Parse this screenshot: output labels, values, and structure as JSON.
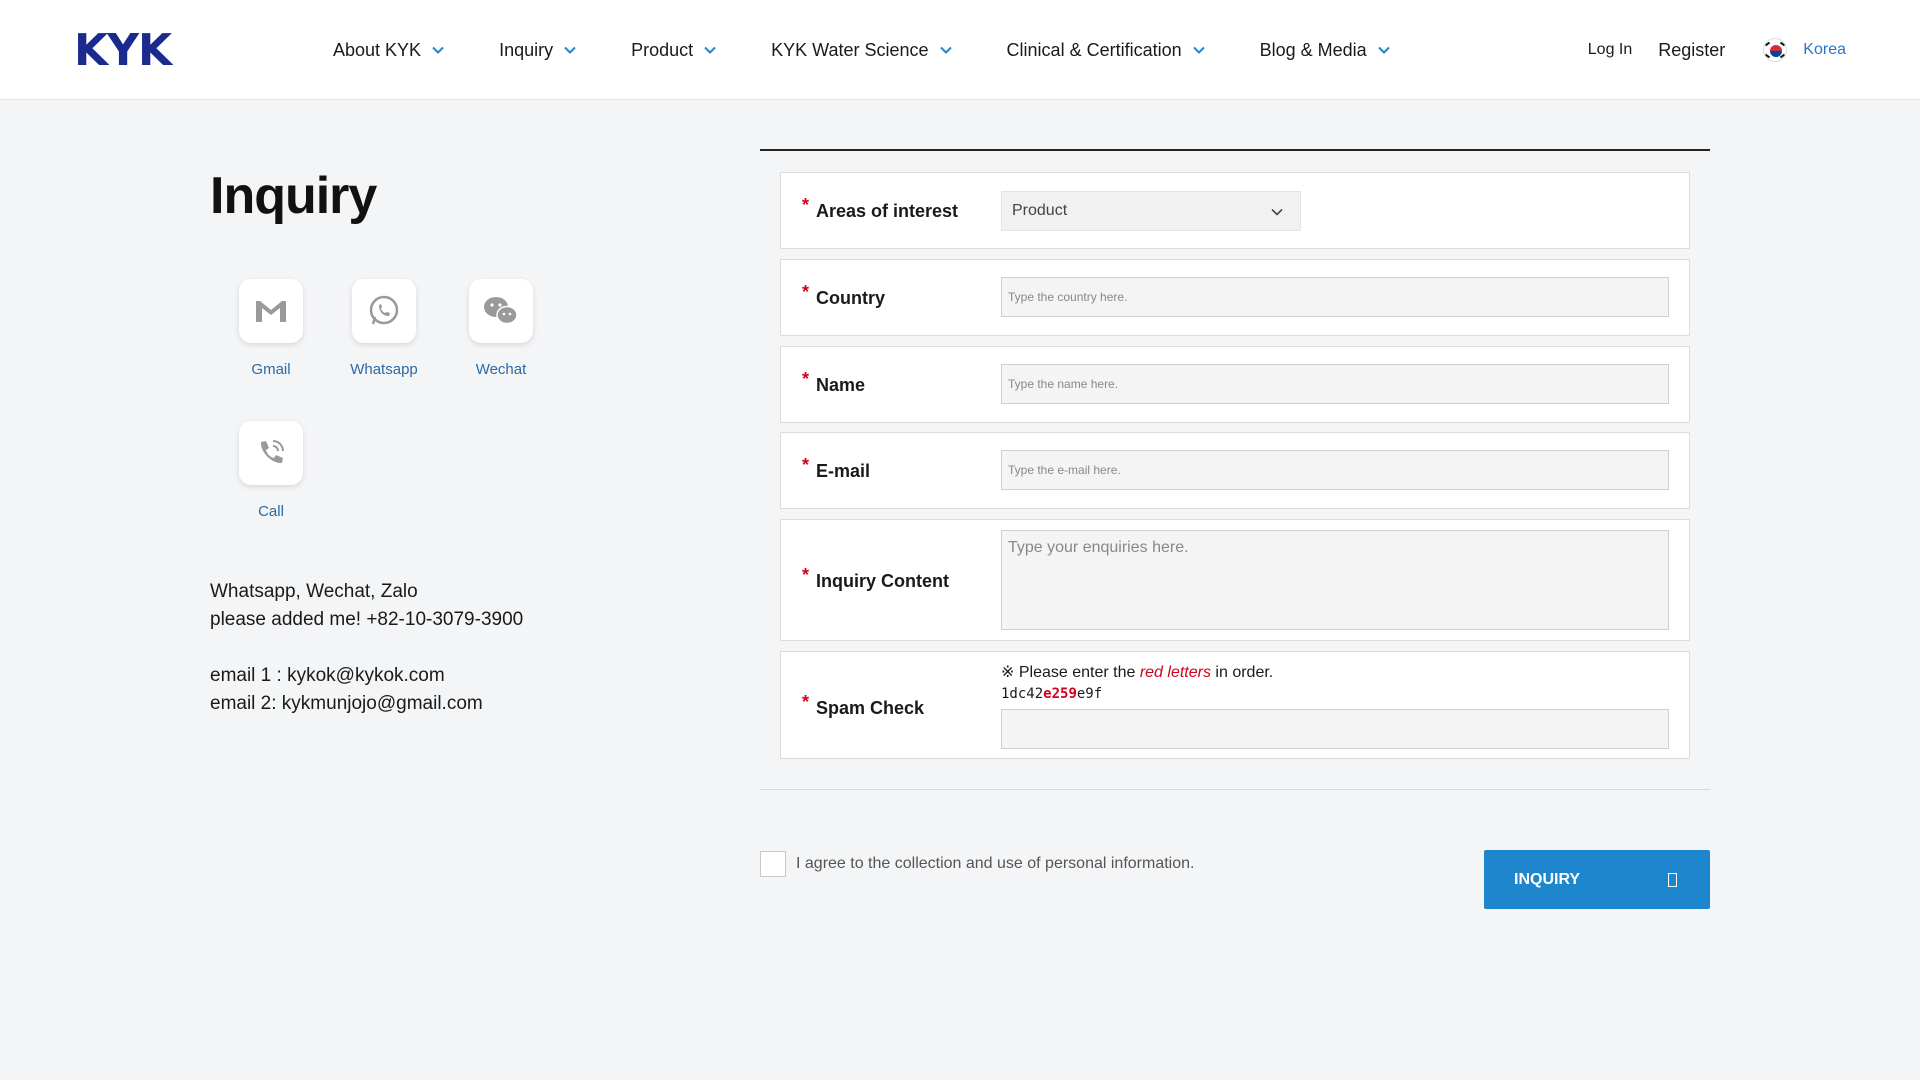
{
  "brand": {
    "logo": "KYK"
  },
  "nav": {
    "items": [
      {
        "label": "About KYK"
      },
      {
        "label": "Inquiry"
      },
      {
        "label": "Product"
      },
      {
        "label": "KYK Water Science"
      },
      {
        "label": "Clinical & Certification"
      },
      {
        "label": "Blog & Media"
      }
    ]
  },
  "header_right": {
    "login": "Log In",
    "register": "Register",
    "language": "Korea"
  },
  "page": {
    "title": "Inquiry"
  },
  "contacts": [
    {
      "label": "Gmail",
      "icon": "gmail-icon"
    },
    {
      "label": "Whatsapp",
      "icon": "whatsapp-icon"
    },
    {
      "label": "Wechat",
      "icon": "wechat-icon"
    },
    {
      "label": "Call",
      "icon": "phone-icon"
    }
  ],
  "info": {
    "line1": "Whatsapp, Wechat, Zalo",
    "line2": "please added me! +82-10-3079-3900",
    "line3": "email 1 : kykok@kykok.com",
    "line4": "email 2: kykmunjojo@gmail.com"
  },
  "form": {
    "required_mark": "*",
    "area": {
      "label": "Areas of interest",
      "value": "Product"
    },
    "country": {
      "label": "Country",
      "placeholder": "Type the country here."
    },
    "name": {
      "label": "Name",
      "placeholder": "Type the name here."
    },
    "email": {
      "label": "E-mail",
      "placeholder": "Type the e-mail here."
    },
    "content": {
      "label": "Inquiry Content",
      "placeholder": "Type your enquiries here."
    },
    "spam": {
      "label": "Spam Check",
      "note_prefix": "※ Please enter the ",
      "note_emph": "red letters",
      "note_suffix": " in order.",
      "code_prefix": "1dc42",
      "code_red": "e259",
      "code_suffix": "e9f"
    }
  },
  "agree": {
    "text": "I agree to the collection and use of personal information."
  },
  "submit": {
    "label": "INQUIRY"
  },
  "colors": {
    "brand": "#1b2a8f",
    "accent": "#1e86cc",
    "required": "#d0021b",
    "link": "#2a6aa8"
  }
}
